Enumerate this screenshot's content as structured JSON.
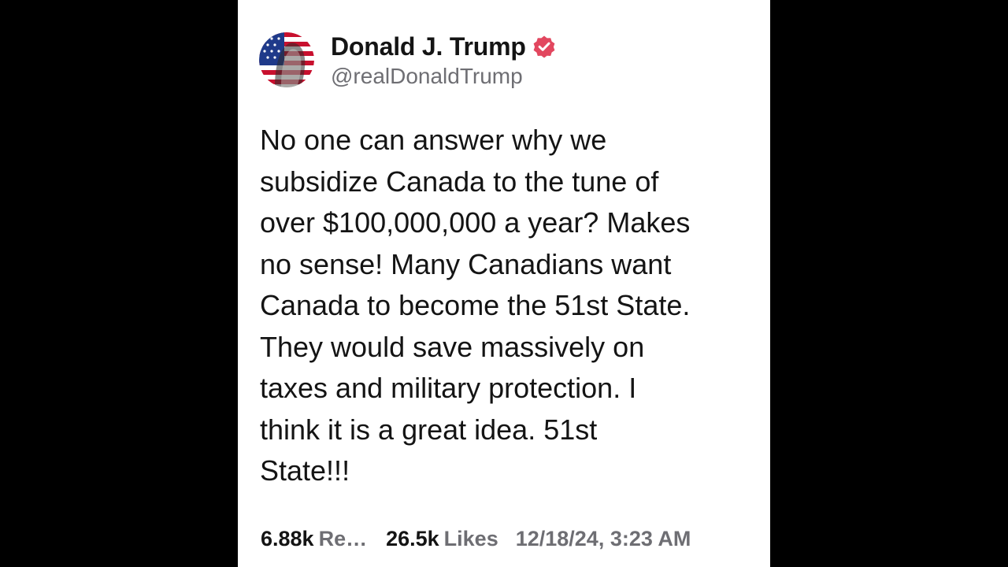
{
  "post": {
    "author": {
      "display_name": "Donald J. Trump",
      "handle": "@realDonaldTrump",
      "verified": true,
      "verified_color": "#e2475f"
    },
    "text": "No one can answer why we\nsubsidize Canada to the tune of\nover $100,000,000 a year? Makes\nno sense! Many Canadians want\nCanada to become the 51st State.\nThey would save massively on\ntaxes and military protection. I\nthink it is a great idea. 51st\nState!!!",
    "stats": {
      "reposts_count": "6.88k",
      "reposts_label": "Re…",
      "likes_count": "26.5k",
      "likes_label": "Likes",
      "timestamp": "12/18/24, 3:23 AM"
    }
  },
  "colors": {
    "background": "#000000",
    "card": "#ffffff",
    "text": "#141414",
    "muted": "#6e6e73"
  },
  "icons": {
    "avatar": "flag-portrait-avatar",
    "verified": "verified-badge-icon"
  }
}
